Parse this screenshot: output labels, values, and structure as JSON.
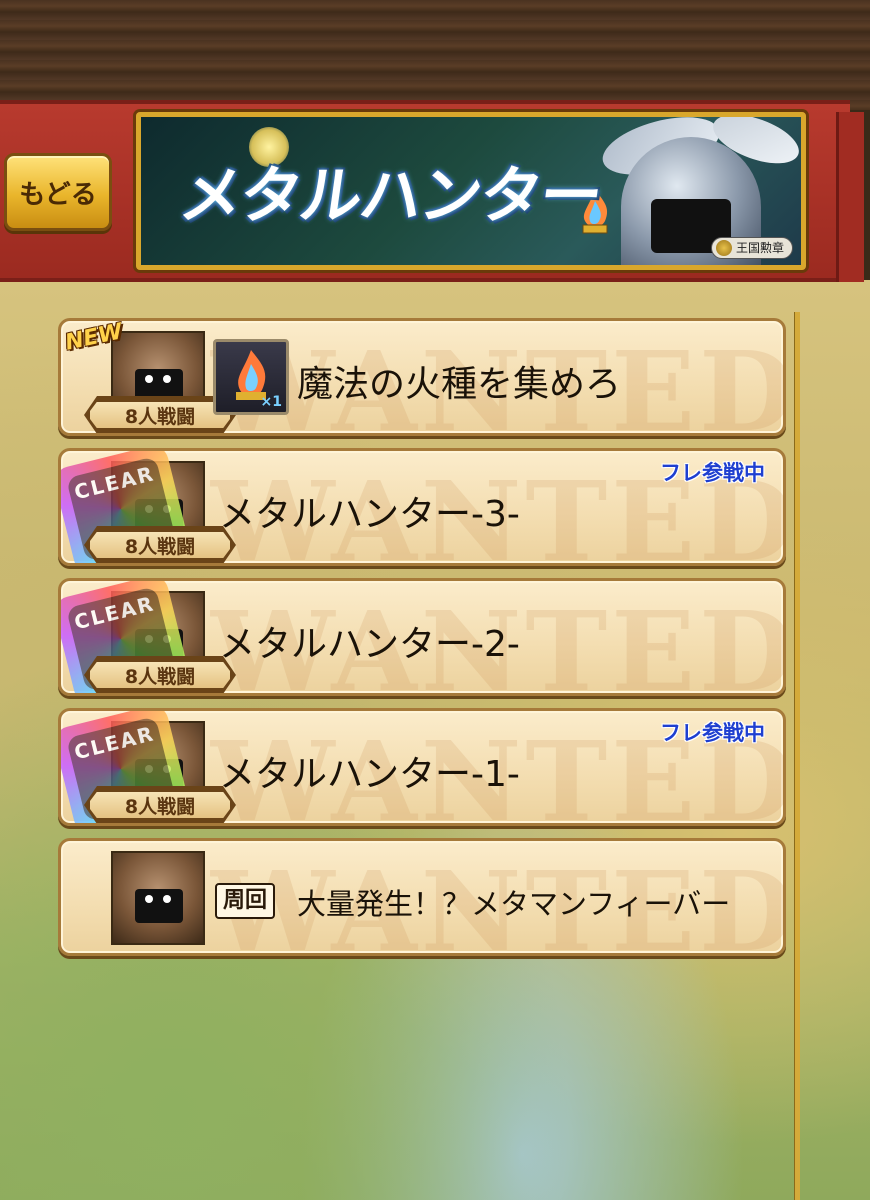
{
  "header": {
    "back_label": "もどる",
    "banner_title": "メタルハンター",
    "banner_badge": "王国勲章"
  },
  "quests": [
    {
      "title": "魔法の火種を集めろ",
      "battle_tag": "8人戦闘",
      "new_badge": "NEW",
      "item_count": "×1",
      "friend_status": "",
      "cleared": false
    },
    {
      "title": "メタルハンター-3-",
      "battle_tag": "8人戦闘",
      "friend_status": "フレ参戦中",
      "cleared": true,
      "clear_text": "CLEAR"
    },
    {
      "title": "メタルハンター-2-",
      "battle_tag": "8人戦闘",
      "friend_status": "",
      "cleared": true,
      "clear_text": "CLEAR"
    },
    {
      "title": "メタルハンター-1-",
      "battle_tag": "8人戦闘",
      "friend_status": "フレ参戦中",
      "cleared": true,
      "clear_text": "CLEAR"
    },
    {
      "title": "大量発生！？メタマンフィーバー",
      "repeat_tag": "周回"
    }
  ],
  "watermark": "WANTED",
  "colors": {
    "header_red": "#b83a2e",
    "gold": "#e9b52b",
    "friend_blue": "#1e3fd0",
    "card_bg": "#f3ddb0"
  }
}
